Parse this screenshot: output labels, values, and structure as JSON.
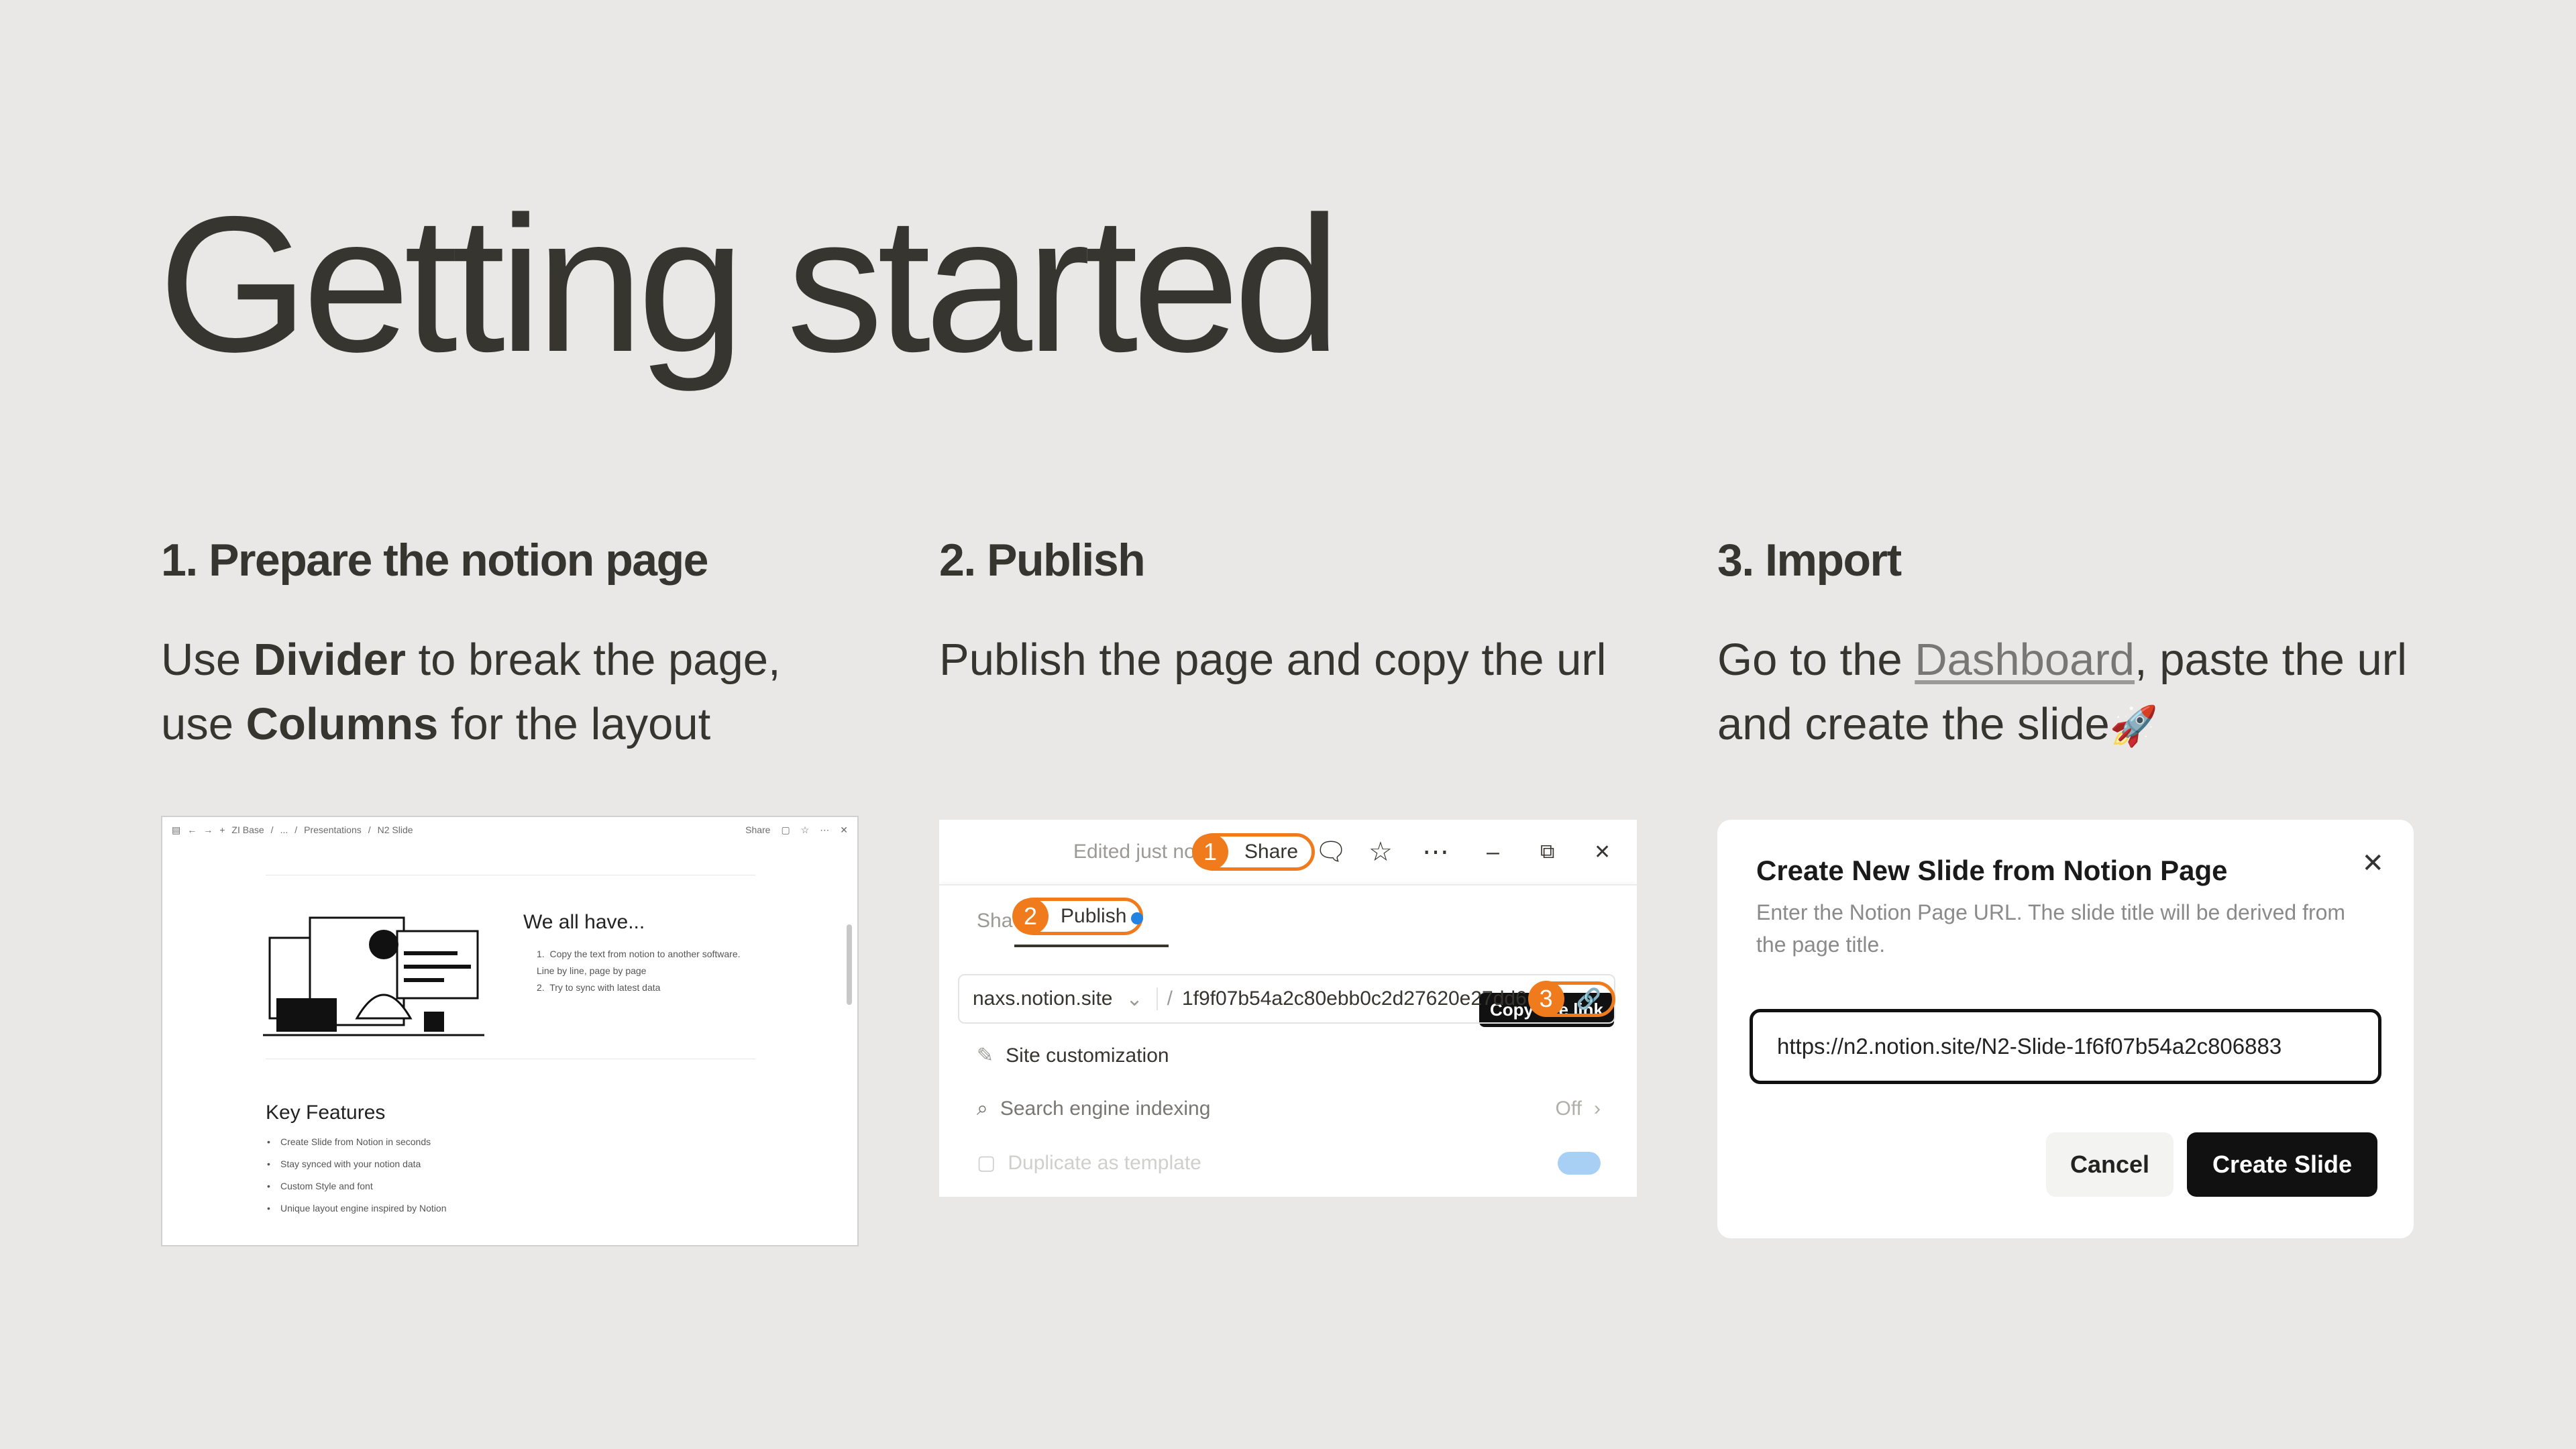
{
  "title": "Getting started",
  "steps": [
    {
      "heading": "1. Prepare the notion page",
      "desc_parts": [
        "Use ",
        "Divider",
        " to break the page,",
        "use ",
        "Columns",
        " for the layout"
      ]
    },
    {
      "heading": "2. Publish",
      "desc": "Publish the page and copy the url"
    },
    {
      "heading": "3. Import",
      "desc_before": "Go to the ",
      "link": "Dashboard",
      "desc_after": ", paste the url",
      "desc_line2": "and create the slide",
      "emoji": "🚀"
    }
  ],
  "card1": {
    "breadcrumb": [
      "ZI Base",
      "...",
      "Presentations",
      "N2 Slide"
    ],
    "share": "Share",
    "heading1": "We all have...",
    "list": [
      "Copy the text from notion to another software. Line by line, page by page",
      "Try to sync with latest data"
    ],
    "heading2": "Key Features",
    "features": [
      "Create Slide from Notion in seconds",
      "Stay synced with your notion data",
      "Custom Style and font",
      "Unique layout engine inspired by Notion"
    ]
  },
  "card2": {
    "edited": "Edited just no",
    "share": "Share",
    "tab_share": "Sha",
    "tab_publish": "Publish",
    "tooltip": "Copy site link",
    "domain": "naxs.notion.site",
    "path": "1f9f07b54a2c80ebb0c2d27620e27dd6",
    "rows": [
      "Site customization",
      "Search engine indexing",
      "Duplicate as template"
    ],
    "indexing_value": "Off",
    "markers": [
      "1",
      "2",
      "3"
    ]
  },
  "card3": {
    "title": "Create New Slide from Notion Page",
    "subtitle": "Enter the Notion Page URL. The slide title will be derived from the page title.",
    "input_value": "https://n2.notion.site/N2-Slide-1f6f07b54a2c806883",
    "cancel": "Cancel",
    "create": "Create Slide"
  }
}
